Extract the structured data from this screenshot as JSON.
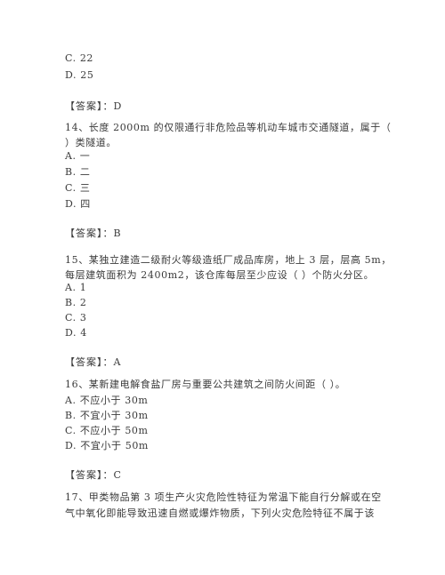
{
  "document": {
    "prev_question_tail": {
      "options": [
        "C. 22",
        "D. 25"
      ],
      "answer_label": "【答案】：",
      "answer": "D"
    },
    "questions": [
      {
        "number": "14",
        "text_lines": [
          "14、长度 2000m 的仅限通行非危险品等机动车城市交通隧道，属于（",
          "）类隧道。"
        ],
        "options": [
          "A. 一",
          "B. 二",
          "C. 三",
          "D. 四"
        ],
        "answer_label": "【答案】：",
        "answer": "B"
      },
      {
        "number": "15",
        "text_lines": [
          "15、某独立建造二级耐火等级造纸厂成品库房，地上 3 层，层高 5m，",
          "每层建筑面积为 2400m2，该仓库每层至少应设（    ）个防火分区。"
        ],
        "options": [
          "A. 1",
          "B. 2",
          "C. 3",
          "D. 4"
        ],
        "answer_label": "【答案】：",
        "answer": "A"
      },
      {
        "number": "16",
        "text_lines": [
          "16、某新建电解食盐厂房与重要公共建筑之间防火间距（    ）。"
        ],
        "options": [
          "A. 不应小于 30m",
          "B. 不宜小于 30m",
          "C. 不应小于 50m",
          "D. 不宜小于 50m"
        ],
        "answer_label": "【答案】：",
        "answer": "C"
      },
      {
        "number": "17",
        "text_lines": [
          "17、甲类物品第 3 项生产火灾危险性特征为常温下能自行分解或在空",
          "气中氧化即能导致迅速自燃或爆炸物质，下列火灾危险特征不属于该"
        ]
      }
    ]
  }
}
